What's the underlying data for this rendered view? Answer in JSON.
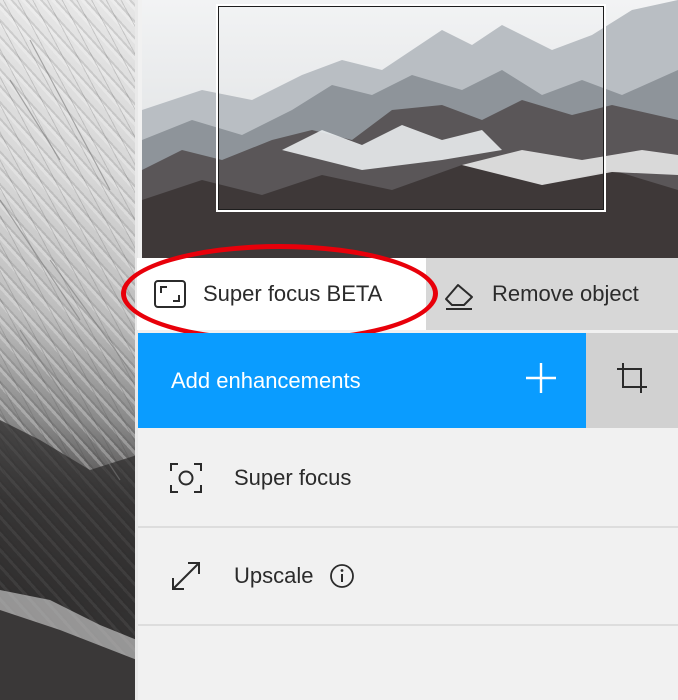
{
  "tabs": {
    "super_focus": {
      "label": "Super focus",
      "badge": "BETA"
    },
    "remove_object": {
      "label": "Remove object"
    }
  },
  "add_enhancements": {
    "label": "Add enhancements"
  },
  "list": {
    "items": [
      {
        "label": "Super focus",
        "icon": "focus-target-icon"
      },
      {
        "label": "Upscale",
        "icon": "expand-arrows-icon"
      }
    ]
  },
  "colors": {
    "accent": "#0a9cff",
    "highlight": "#e8000a",
    "tab_inactive": "#d7d7d7",
    "panel_bg": "#f1f1f1"
  }
}
